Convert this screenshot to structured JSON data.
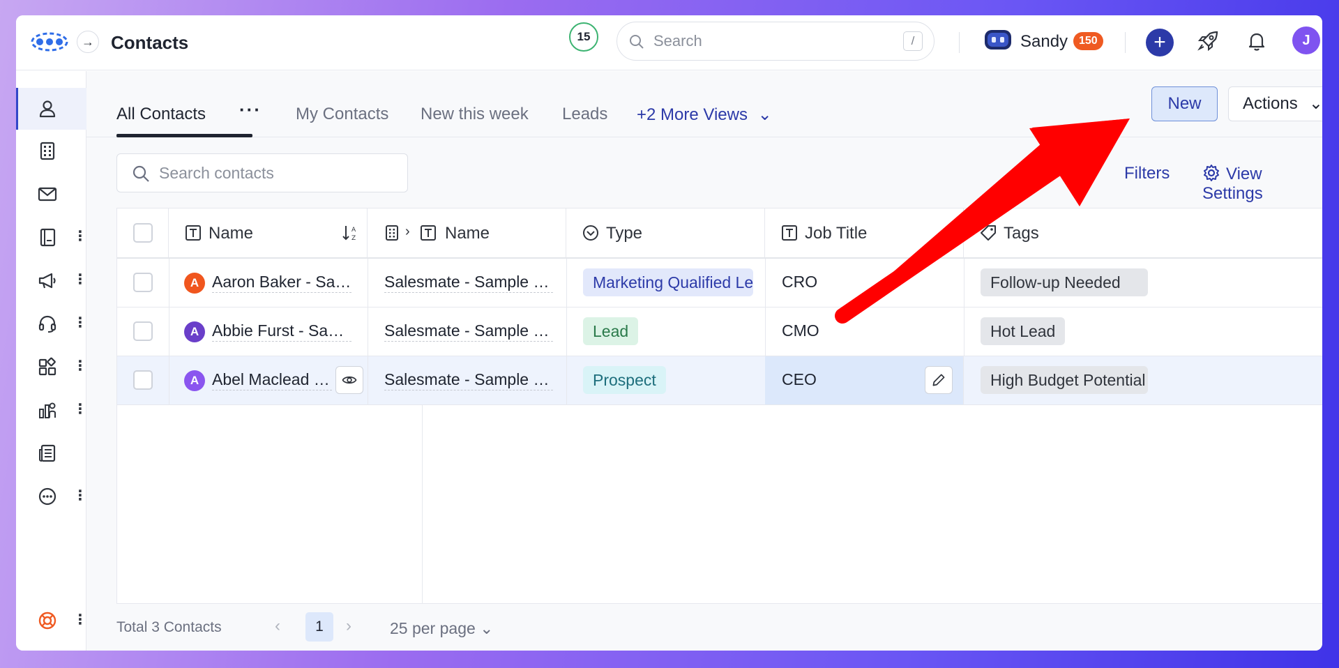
{
  "header": {
    "title": "Contacts",
    "notification_count": "15",
    "search_placeholder": "Search",
    "search_shortcut": "/",
    "user_name": "Sandy",
    "user_points": "150",
    "avatar_initial": "J"
  },
  "views": {
    "tabs": [
      {
        "label": "All Contacts"
      },
      {
        "label": "My Contacts"
      },
      {
        "label": "New this week"
      },
      {
        "label": "Leads"
      }
    ],
    "more_label": "+2 More Views",
    "new_label": "New",
    "actions_label": "Actions"
  },
  "toolbar": {
    "search_placeholder": "Search contacts",
    "filters_label": "Filters",
    "view_settings_label": "View Settings"
  },
  "table": {
    "columns": [
      "Name",
      "Name",
      "Type",
      "Job Title",
      "Tags"
    ],
    "rows": [
      {
        "initial": "A",
        "avatar_color": "#f0561e",
        "name": "Aaron Baker - Sample Contact",
        "company": "Salesmate - Sample Company",
        "type": "Marketing Qualified Lead",
        "type_bg": "#e2e8fb",
        "type_fg": "#2c3aa8",
        "job_title": "CRO",
        "tag": "Follow-up Needed"
      },
      {
        "initial": "A",
        "avatar_color": "#6a3fc9",
        "name": "Abbie Furst - Sample Contact",
        "company": "Salesmate - Sample Company",
        "type": "Lead",
        "type_bg": "#dcf3e6",
        "type_fg": "#2a7a4a",
        "job_title": "CMO",
        "tag": "Hot Lead"
      },
      {
        "initial": "A",
        "avatar_color": "#8a55ef",
        "name": "Abel Maclead - Sample Contact",
        "company": "Salesmate - Sample Company",
        "type": "Prospect",
        "type_bg": "#d9f3f7",
        "type_fg": "#1d6e7c",
        "job_title": "CEO",
        "tag": "High Budget Potential"
      }
    ]
  },
  "footer": {
    "total_label": "Total 3 Contacts",
    "current_page": "1",
    "per_page_label": "25 per page"
  },
  "colors": {
    "accent": "#2c3aa8",
    "annotation_arrow": "#ff0000",
    "points_badge": "#ef5a22",
    "avatar": "#7f53f0"
  }
}
